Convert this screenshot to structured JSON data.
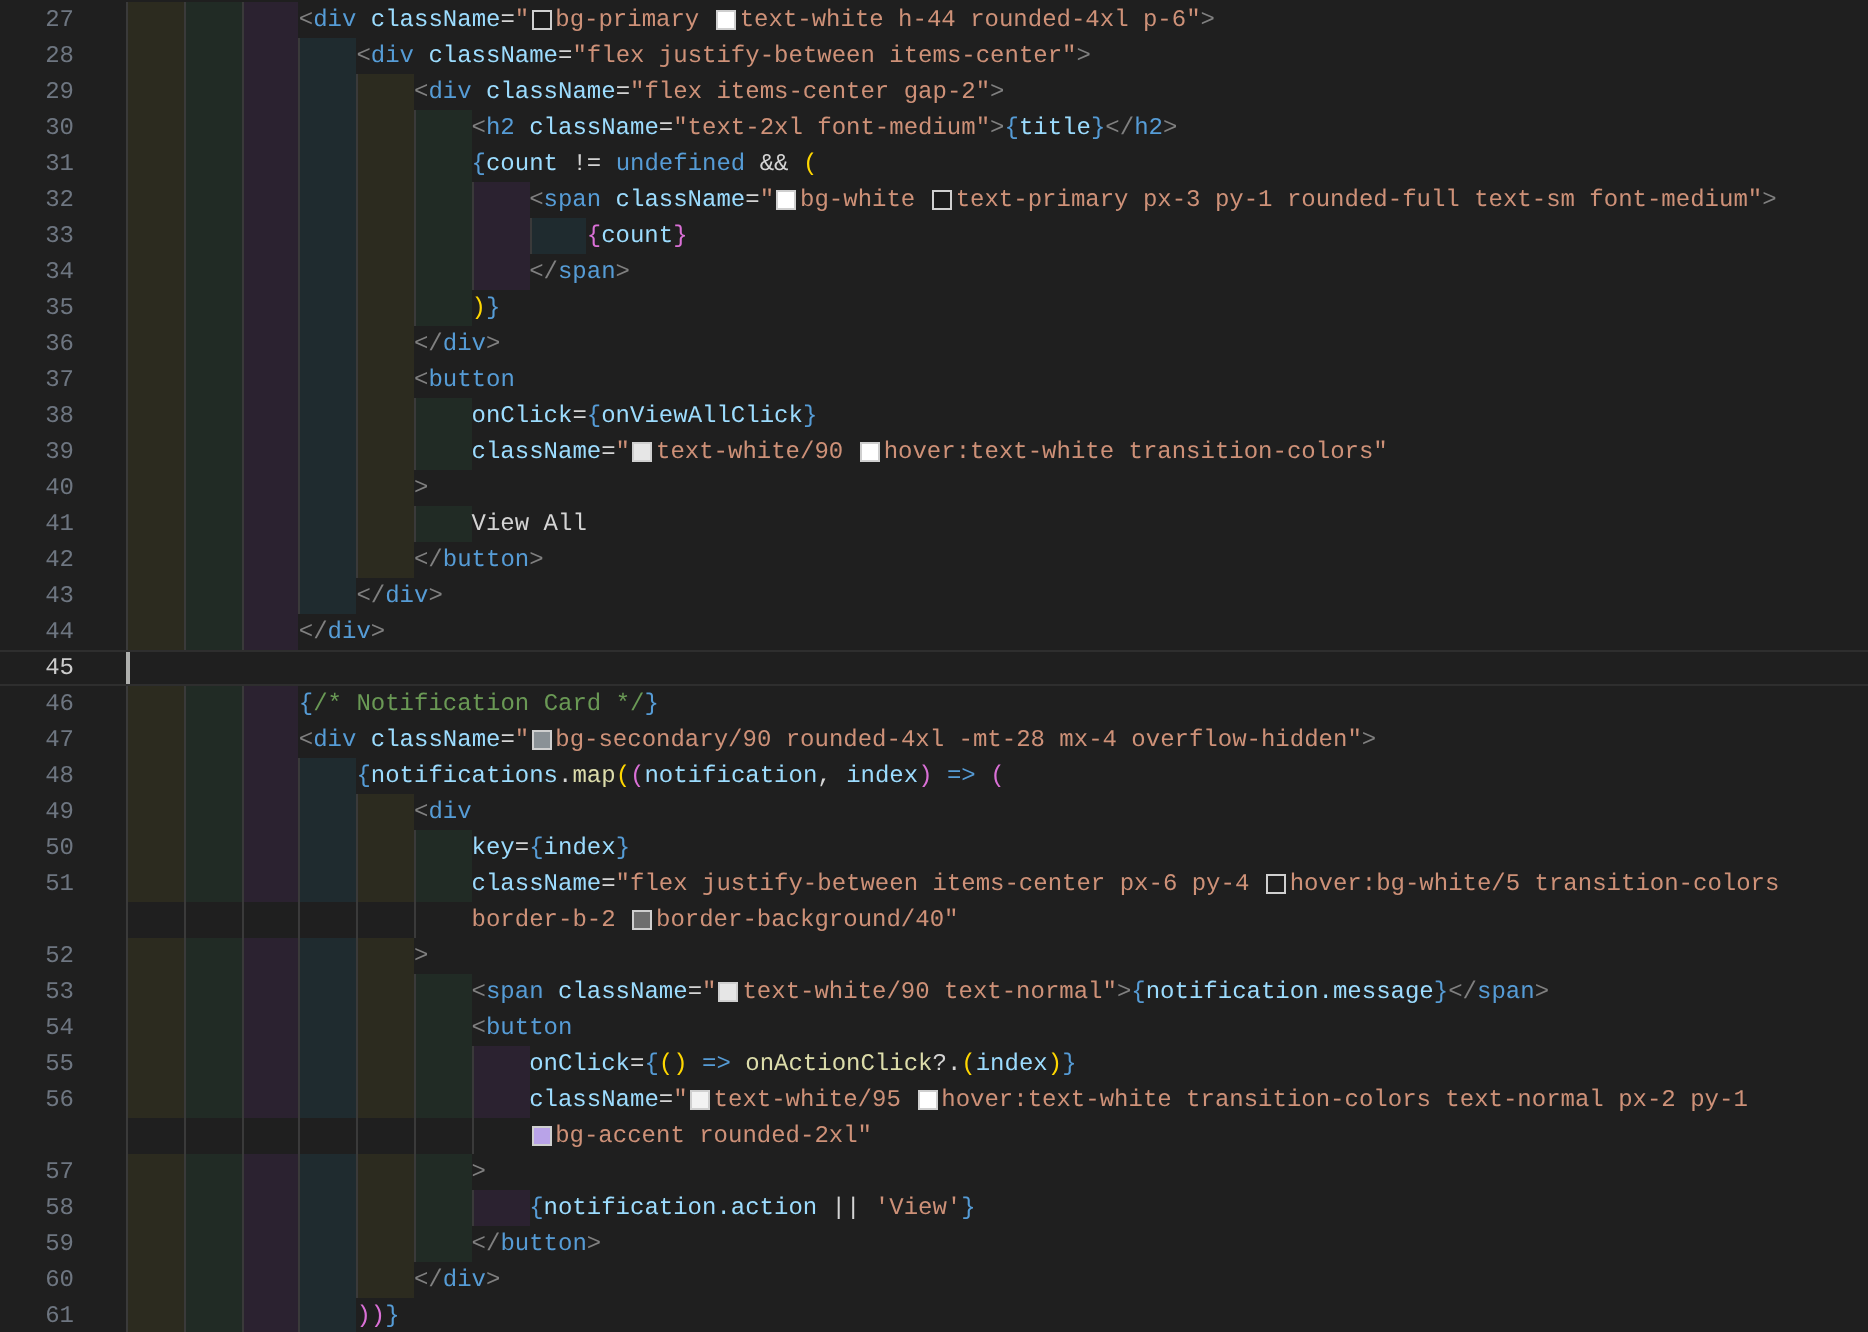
{
  "editor": {
    "lines": [
      {
        "number": "27",
        "current": false,
        "rows": [
          [
            {
              "kind": "punct",
              "text": "            <"
            },
            {
              "kind": "tag",
              "text": "div"
            },
            {
              "kind": "attr",
              "text": " className"
            },
            {
              "kind": "op",
              "text": "="
            },
            {
              "kind": "str",
              "text": "\""
            },
            {
              "kind": "swatch",
              "color": "#1a1a1a"
            },
            {
              "kind": "str",
              "text": "bg-primary "
            },
            {
              "kind": "swatch",
              "color": "#ffffff"
            },
            {
              "kind": "str",
              "text": "text-white h-44 rounded-4xl p-6\""
            },
            {
              "kind": "punct",
              "text": ">"
            }
          ]
        ]
      },
      {
        "number": "28",
        "current": false,
        "rows": [
          [
            {
              "kind": "punct",
              "text": "                <"
            },
            {
              "kind": "tag",
              "text": "div"
            },
            {
              "kind": "attr",
              "text": " className"
            },
            {
              "kind": "op",
              "text": "="
            },
            {
              "kind": "str",
              "text": "\"flex justify-between items-center\""
            },
            {
              "kind": "punct",
              "text": ">"
            }
          ]
        ]
      },
      {
        "number": "29",
        "current": false,
        "rows": [
          [
            {
              "kind": "punct",
              "text": "                    <"
            },
            {
              "kind": "tag",
              "text": "div"
            },
            {
              "kind": "attr",
              "text": " className"
            },
            {
              "kind": "op",
              "text": "="
            },
            {
              "kind": "str",
              "text": "\"flex items-center gap-2\""
            },
            {
              "kind": "punct",
              "text": ">"
            }
          ]
        ]
      },
      {
        "number": "30",
        "current": false,
        "rows": [
          [
            {
              "kind": "punct",
              "text": "                        <"
            },
            {
              "kind": "tag",
              "text": "h2"
            },
            {
              "kind": "attr",
              "text": " className"
            },
            {
              "kind": "op",
              "text": "="
            },
            {
              "kind": "str",
              "text": "\"text-2xl font-medium\""
            },
            {
              "kind": "punct",
              "text": ">"
            },
            {
              "kind": "brace",
              "text": "{"
            },
            {
              "kind": "var",
              "text": "title"
            },
            {
              "kind": "brace",
              "text": "}"
            },
            {
              "kind": "punct",
              "text": "</"
            },
            {
              "kind": "tag",
              "text": "h2"
            },
            {
              "kind": "punct",
              "text": ">"
            }
          ]
        ]
      },
      {
        "number": "31",
        "current": false,
        "rows": [
          [
            {
              "kind": "brace",
              "text": "                        {"
            },
            {
              "kind": "var",
              "text": "count"
            },
            {
              "kind": "op",
              "text": " != "
            },
            {
              "kind": "kw",
              "text": "undefined"
            },
            {
              "kind": "op",
              "text": " && "
            },
            {
              "kind": "paren1",
              "text": "("
            }
          ]
        ]
      },
      {
        "number": "32",
        "current": false,
        "rows": [
          [
            {
              "kind": "punct",
              "text": "                            <"
            },
            {
              "kind": "tag",
              "text": "span"
            },
            {
              "kind": "attr",
              "text": " className"
            },
            {
              "kind": "op",
              "text": "="
            },
            {
              "kind": "str",
              "text": "\""
            },
            {
              "kind": "swatch",
              "color": "#ffffff"
            },
            {
              "kind": "str",
              "text": "bg-white "
            },
            {
              "kind": "swatch",
              "color": "#1a1a1a"
            },
            {
              "kind": "str",
              "text": "text-primary px-3 py-1 rounded-full text-sm font-medium\""
            },
            {
              "kind": "punct",
              "text": ">"
            }
          ]
        ]
      },
      {
        "number": "33",
        "current": false,
        "rows": [
          [
            {
              "kind": "paren2",
              "text": "                                {"
            },
            {
              "kind": "var",
              "text": "count"
            },
            {
              "kind": "paren2",
              "text": "}"
            }
          ]
        ]
      },
      {
        "number": "34",
        "current": false,
        "rows": [
          [
            {
              "kind": "punct",
              "text": "                            </"
            },
            {
              "kind": "tag",
              "text": "span"
            },
            {
              "kind": "punct",
              "text": ">"
            }
          ]
        ]
      },
      {
        "number": "35",
        "current": false,
        "rows": [
          [
            {
              "kind": "paren1",
              "text": "                        )"
            },
            {
              "kind": "brace",
              "text": "}"
            }
          ]
        ]
      },
      {
        "number": "36",
        "current": false,
        "rows": [
          [
            {
              "kind": "punct",
              "text": "                    </"
            },
            {
              "kind": "tag",
              "text": "div"
            },
            {
              "kind": "punct",
              "text": ">"
            }
          ]
        ]
      },
      {
        "number": "37",
        "current": false,
        "rows": [
          [
            {
              "kind": "punct",
              "text": "                    <"
            },
            {
              "kind": "tag",
              "text": "button"
            }
          ]
        ]
      },
      {
        "number": "38",
        "current": false,
        "rows": [
          [
            {
              "kind": "attr",
              "text": "                        onClick"
            },
            {
              "kind": "op",
              "text": "="
            },
            {
              "kind": "brace",
              "text": "{"
            },
            {
              "kind": "var",
              "text": "onViewAllClick"
            },
            {
              "kind": "brace",
              "text": "}"
            }
          ]
        ]
      },
      {
        "number": "39",
        "current": false,
        "rows": [
          [
            {
              "kind": "attr",
              "text": "                        className"
            },
            {
              "kind": "op",
              "text": "="
            },
            {
              "kind": "str",
              "text": "\""
            },
            {
              "kind": "swatch",
              "color": "#e6e6e6"
            },
            {
              "kind": "str",
              "text": "text-white/90 "
            },
            {
              "kind": "swatch",
              "color": "#ffffff"
            },
            {
              "kind": "str",
              "text": "hover:text-white transition-colors\""
            }
          ]
        ]
      },
      {
        "number": "40",
        "current": false,
        "rows": [
          [
            {
              "kind": "punct",
              "text": "                    >"
            }
          ]
        ]
      },
      {
        "number": "41",
        "current": false,
        "rows": [
          [
            {
              "kind": "text",
              "text": "                        View All"
            }
          ]
        ]
      },
      {
        "number": "42",
        "current": false,
        "rows": [
          [
            {
              "kind": "punct",
              "text": "                    </"
            },
            {
              "kind": "tag",
              "text": "button"
            },
            {
              "kind": "punct",
              "text": ">"
            }
          ]
        ]
      },
      {
        "number": "43",
        "current": false,
        "rows": [
          [
            {
              "kind": "punct",
              "text": "                </"
            },
            {
              "kind": "tag",
              "text": "div"
            },
            {
              "kind": "punct",
              "text": ">"
            }
          ]
        ]
      },
      {
        "number": "44",
        "current": false,
        "rows": [
          [
            {
              "kind": "punct",
              "text": "            </"
            },
            {
              "kind": "tag",
              "text": "div"
            },
            {
              "kind": "punct",
              "text": ">"
            }
          ]
        ]
      },
      {
        "number": "45",
        "current": true
      },
      {
        "number": "46",
        "current": false,
        "rows": [
          [
            {
              "kind": "brace",
              "text": "            {"
            },
            {
              "kind": "comment",
              "text": "/* Notification Card */"
            },
            {
              "kind": "brace",
              "text": "}"
            }
          ]
        ]
      },
      {
        "number": "47",
        "current": false,
        "rows": [
          [
            {
              "kind": "punct",
              "text": "            <"
            },
            {
              "kind": "tag",
              "text": "div"
            },
            {
              "kind": "attr",
              "text": " className"
            },
            {
              "kind": "op",
              "text": "="
            },
            {
              "kind": "str",
              "text": "\""
            },
            {
              "kind": "swatch",
              "color": "#8a9196"
            },
            {
              "kind": "str",
              "text": "bg-secondary/90 rounded-4xl -mt-28 mx-4 overflow-hidden\""
            },
            {
              "kind": "punct",
              "text": ">"
            }
          ]
        ]
      },
      {
        "number": "48",
        "current": false,
        "rows": [
          [
            {
              "kind": "brace",
              "text": "                {"
            },
            {
              "kind": "var",
              "text": "notifications"
            },
            {
              "kind": "op",
              "text": "."
            },
            {
              "kind": "fn",
              "text": "map"
            },
            {
              "kind": "paren1",
              "text": "("
            },
            {
              "kind": "paren2",
              "text": "("
            },
            {
              "kind": "var",
              "text": "notification"
            },
            {
              "kind": "op",
              "text": ", "
            },
            {
              "kind": "var",
              "text": "index"
            },
            {
              "kind": "paren2",
              "text": ")"
            },
            {
              "kind": "kw",
              "text": " => "
            },
            {
              "kind": "paren2",
              "text": "("
            }
          ]
        ]
      },
      {
        "number": "49",
        "current": false,
        "rows": [
          [
            {
              "kind": "punct",
              "text": "                    <"
            },
            {
              "kind": "tag",
              "text": "div"
            }
          ]
        ]
      },
      {
        "number": "50",
        "current": false,
        "rows": [
          [
            {
              "kind": "attr",
              "text": "                        key"
            },
            {
              "kind": "op",
              "text": "="
            },
            {
              "kind": "brace",
              "text": "{"
            },
            {
              "kind": "var",
              "text": "index"
            },
            {
              "kind": "brace",
              "text": "}"
            }
          ]
        ]
      },
      {
        "number": "51",
        "current": false,
        "rows": [
          [
            {
              "kind": "attr",
              "text": "                        className"
            },
            {
              "kind": "op",
              "text": "="
            },
            {
              "kind": "str",
              "text": "\"flex justify-between items-center px-6 py-4 "
            },
            {
              "kind": "swatch",
              "color": "#1f1f1f"
            },
            {
              "kind": "str",
              "text": "hover:bg-white/5 transition-colors"
            }
          ],
          [
            {
              "kind": "str",
              "text": "border-b-2 "
            },
            {
              "kind": "swatch",
              "color": "#6e6e6e"
            },
            {
              "kind": "str",
              "text": "border-background/40\""
            }
          ]
        ]
      },
      {
        "number": "52",
        "current": false,
        "rows": [
          [
            {
              "kind": "punct",
              "text": "                    >"
            }
          ]
        ]
      },
      {
        "number": "53",
        "current": false,
        "rows": [
          [
            {
              "kind": "punct",
              "text": "                        <"
            },
            {
              "kind": "tag",
              "text": "span"
            },
            {
              "kind": "attr",
              "text": " className"
            },
            {
              "kind": "op",
              "text": "="
            },
            {
              "kind": "str",
              "text": "\""
            },
            {
              "kind": "swatch",
              "color": "#e6e6e6"
            },
            {
              "kind": "str",
              "text": "text-white/90 text-normal\""
            },
            {
              "kind": "punct",
              "text": ">"
            },
            {
              "kind": "brace",
              "text": "{"
            },
            {
              "kind": "var",
              "text": "notification.message"
            },
            {
              "kind": "brace",
              "text": "}"
            },
            {
              "kind": "punct",
              "text": "</"
            },
            {
              "kind": "tag",
              "text": "span"
            },
            {
              "kind": "punct",
              "text": ">"
            }
          ]
        ]
      },
      {
        "number": "54",
        "current": false,
        "rows": [
          [
            {
              "kind": "punct",
              "text": "                        <"
            },
            {
              "kind": "tag",
              "text": "button"
            }
          ]
        ]
      },
      {
        "number": "55",
        "current": false,
        "rows": [
          [
            {
              "kind": "attr",
              "text": "                            onClick"
            },
            {
              "kind": "op",
              "text": "="
            },
            {
              "kind": "brace",
              "text": "{"
            },
            {
              "kind": "paren1",
              "text": "()"
            },
            {
              "kind": "kw",
              "text": " => "
            },
            {
              "kind": "fn",
              "text": "onActionClick"
            },
            {
              "kind": "op",
              "text": "?."
            },
            {
              "kind": "paren1",
              "text": "("
            },
            {
              "kind": "var",
              "text": "index"
            },
            {
              "kind": "paren1",
              "text": ")"
            },
            {
              "kind": "brace",
              "text": "}"
            }
          ]
        ]
      },
      {
        "number": "56",
        "current": false,
        "rows": [
          [
            {
              "kind": "attr",
              "text": "                            className"
            },
            {
              "kind": "op",
              "text": "="
            },
            {
              "kind": "str",
              "text": "\""
            },
            {
              "kind": "swatch",
              "color": "#f2f2f2"
            },
            {
              "kind": "str",
              "text": "text-white/95 "
            },
            {
              "kind": "swatch",
              "color": "#ffffff"
            },
            {
              "kind": "str",
              "text": "hover:text-white transition-colors text-normal px-2 py-1"
            }
          ],
          [
            {
              "kind": "swatch",
              "color": "#b9a3e8"
            },
            {
              "kind": "str",
              "text": "bg-accent rounded-2xl\""
            }
          ]
        ]
      },
      {
        "number": "57",
        "current": false,
        "rows": [
          [
            {
              "kind": "punct",
              "text": "                        >"
            }
          ]
        ]
      },
      {
        "number": "58",
        "current": false,
        "rows": [
          [
            {
              "kind": "brace",
              "text": "                            {"
            },
            {
              "kind": "var",
              "text": "notification.action"
            },
            {
              "kind": "op",
              "text": " || "
            },
            {
              "kind": "str",
              "text": "'View'"
            },
            {
              "kind": "brace",
              "text": "}"
            }
          ]
        ]
      },
      {
        "number": "59",
        "current": false,
        "rows": [
          [
            {
              "kind": "punct",
              "text": "                        </"
            },
            {
              "kind": "tag",
              "text": "button"
            },
            {
              "kind": "punct",
              "text": ">"
            }
          ]
        ]
      },
      {
        "number": "60",
        "current": false,
        "rows": [
          [
            {
              "kind": "punct",
              "text": "                    </"
            },
            {
              "kind": "tag",
              "text": "div"
            },
            {
              "kind": "punct",
              "text": ">"
            }
          ]
        ]
      },
      {
        "number": "61",
        "current": false,
        "rows": [
          [
            {
              "kind": "paren2",
              "text": "                ))"
            },
            {
              "kind": "brace",
              "text": "}"
            }
          ]
        ]
      }
    ]
  }
}
